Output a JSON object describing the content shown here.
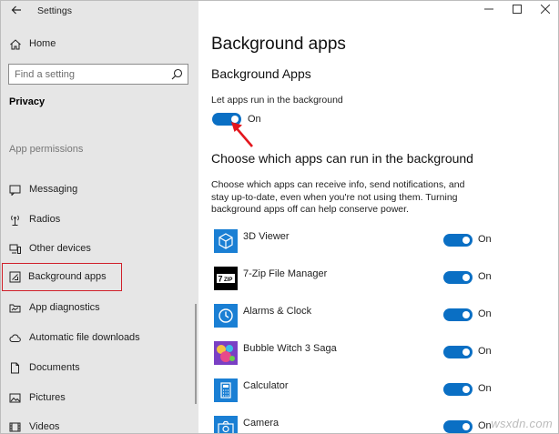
{
  "window": {
    "title": "Settings"
  },
  "sidebar": {
    "home_label": "Home",
    "search_placeholder": "Find a setting",
    "section_title": "Privacy",
    "group_title": "App permissions",
    "items": [
      {
        "label": "Messaging",
        "icon": "message-icon"
      },
      {
        "label": "Radios",
        "icon": "radio-icon"
      },
      {
        "label": "Other devices",
        "icon": "devices-icon"
      },
      {
        "label": "Background apps",
        "icon": "background-apps-icon",
        "selected": true
      },
      {
        "label": "App diagnostics",
        "icon": "diagnostics-icon"
      },
      {
        "label": "Automatic file downloads",
        "icon": "cloud-icon"
      },
      {
        "label": "Documents",
        "icon": "document-icon"
      },
      {
        "label": "Pictures",
        "icon": "picture-icon"
      },
      {
        "label": "Videos",
        "icon": "video-icon"
      }
    ]
  },
  "main": {
    "title": "Background apps",
    "subtitle": "Background Apps",
    "master_toggle": {
      "description": "Let apps run in the background",
      "state": "On"
    },
    "choose_heading": "Choose which apps can run in the background",
    "choose_description": "Choose which apps can receive info, send notifications, and stay up-to-date, even when you're not using them. Turning background apps off can help conserve power.",
    "apps": [
      {
        "name": "3D Viewer",
        "state": "On",
        "icon": "cube-icon",
        "icon_color": "#1a7fd4"
      },
      {
        "name": "7-Zip File Manager",
        "state": "On",
        "icon": "7zip-icon",
        "icon_color": "#000000"
      },
      {
        "name": "Alarms & Clock",
        "state": "On",
        "icon": "clock-icon",
        "icon_color": "#1a7fd4"
      },
      {
        "name": "Bubble Witch 3 Saga",
        "state": "On",
        "icon": "bubble-witch-icon",
        "icon_color": "#7a3fc4"
      },
      {
        "name": "Calculator",
        "state": "On",
        "icon": "calculator-icon",
        "icon_color": "#1a7fd4"
      },
      {
        "name": "Camera",
        "state": "On",
        "icon": "camera-icon",
        "icon_color": "#1a7fd4"
      }
    ]
  },
  "colors": {
    "accent": "#0a6fc4",
    "selection_outline": "#d0202a",
    "sidebar_bg": "#e6e6e6"
  },
  "watermark": "wsxdn.com"
}
